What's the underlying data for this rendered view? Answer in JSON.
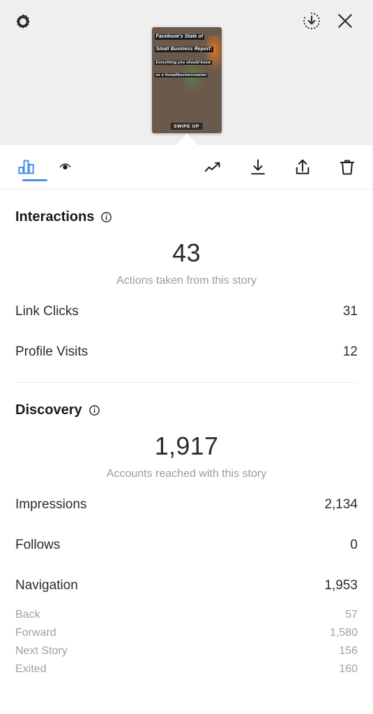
{
  "header": {
    "settings_icon": "gear-icon",
    "download_icon": "download-circle-icon",
    "close_icon": "close-icon",
    "story": {
      "overlay_line1": "Facebook's State of",
      "overlay_line2": "Small Business Report:",
      "overlay_line3": "Everything you should know",
      "overlay_line4": "as a #smallbusinessowner",
      "cta": "SWIPE UP"
    }
  },
  "toolbar": {
    "insights_icon": "bar-chart-icon",
    "viewers_icon": "eye-icon",
    "promote_icon": "trending-up-icon",
    "save_icon": "download-icon",
    "share_icon": "share-icon",
    "delete_icon": "trash-icon",
    "active_tab": "insights",
    "accent_color": "#4a90e8"
  },
  "interactions": {
    "title": "Interactions",
    "info_icon": "info-icon",
    "value": "43",
    "caption": "Actions taken from this story",
    "metrics": [
      {
        "label": "Link Clicks",
        "value": "31"
      },
      {
        "label": "Profile Visits",
        "value": "12"
      }
    ]
  },
  "discovery": {
    "title": "Discovery",
    "info_icon": "info-icon",
    "value": "1,917",
    "caption": "Accounts reached with this story",
    "metrics": [
      {
        "label": "Impressions",
        "value": "2,134"
      },
      {
        "label": "Follows",
        "value": "0"
      },
      {
        "label": "Navigation",
        "value": "1,953"
      }
    ],
    "navigation_breakdown": [
      {
        "label": "Back",
        "value": "57"
      },
      {
        "label": "Forward",
        "value": "1,580"
      },
      {
        "label": "Next Story",
        "value": "156"
      },
      {
        "label": "Exited",
        "value": "160"
      }
    ]
  }
}
